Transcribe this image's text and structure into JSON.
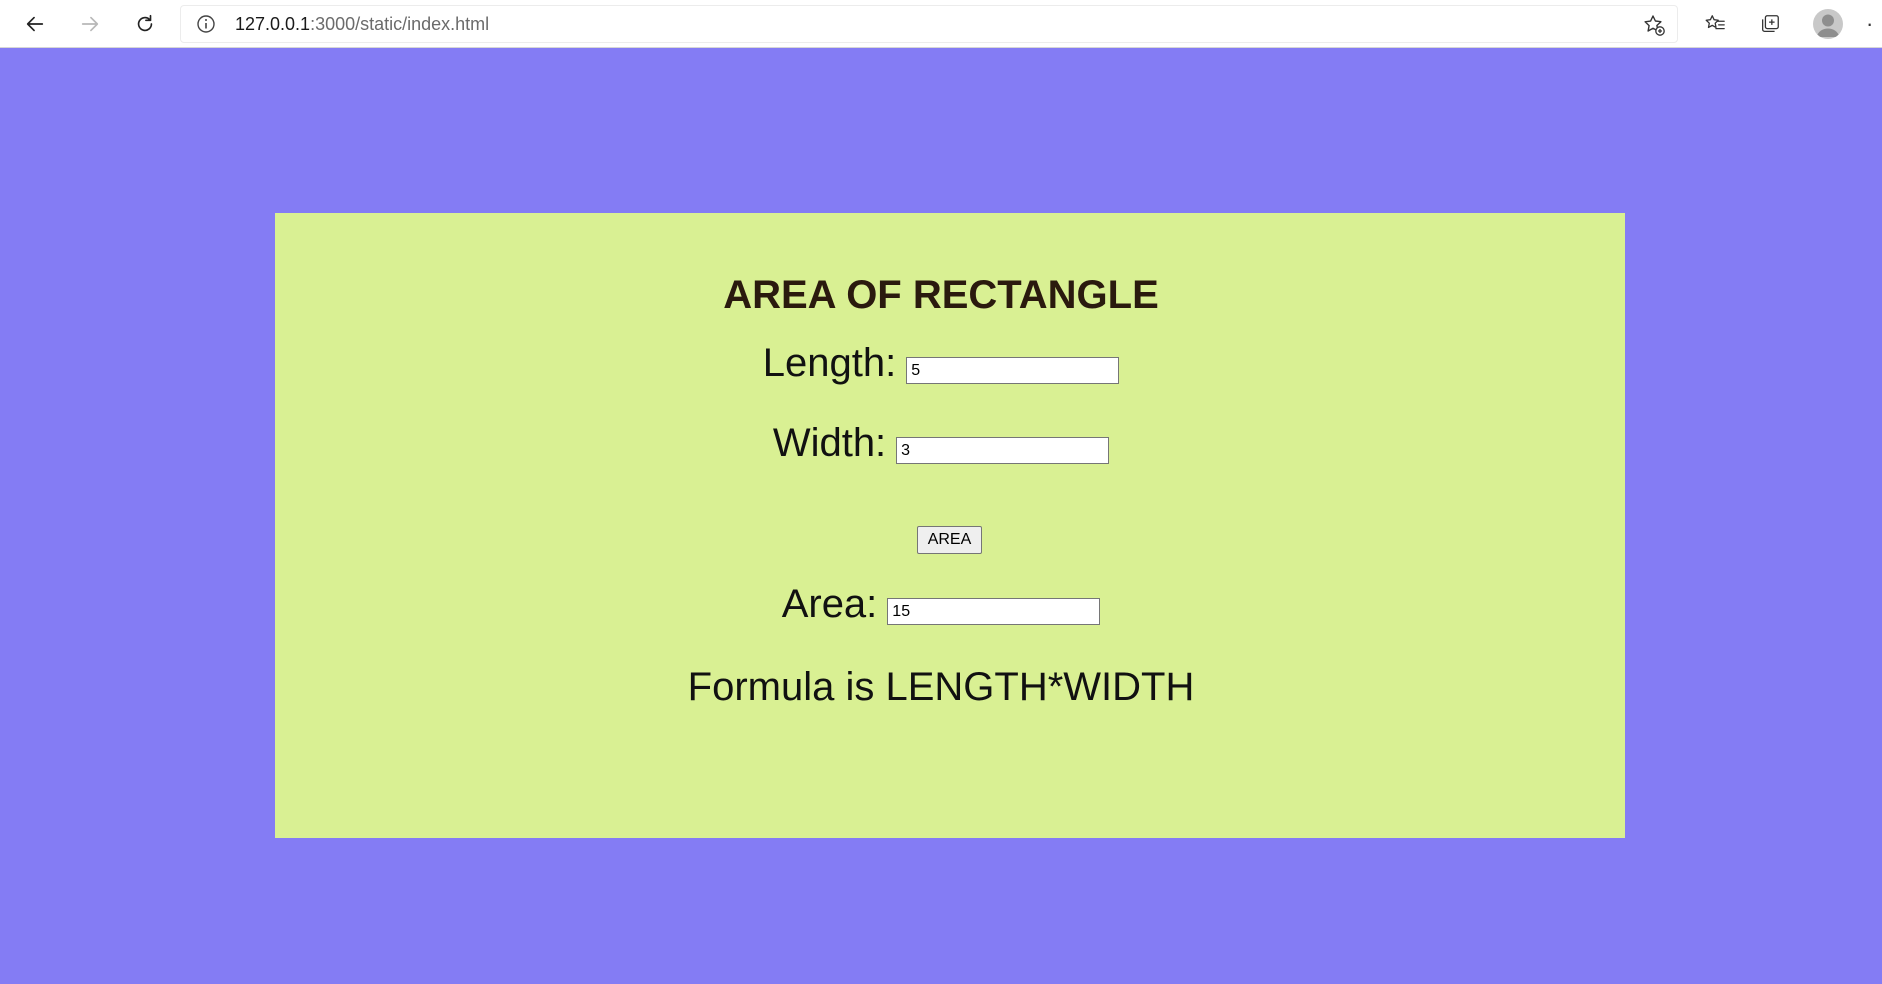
{
  "browser": {
    "url_host": "127.0.0.1",
    "url_path": ":3000/static/index.html",
    "icons": [
      "back-arrow-icon",
      "forward-arrow-icon",
      "reload-icon",
      "info-icon",
      "add-favorite-icon",
      "favorites-icon",
      "collections-icon",
      "profile-avatar",
      "more-icon"
    ]
  },
  "page": {
    "title": "AREA OF RECTANGLE",
    "length_label": "Length:",
    "length_value": "5",
    "width_label": "Width:",
    "width_value": "3",
    "area_button": "AREA",
    "area_label": "Area:",
    "area_value": "15",
    "formula": "Formula is LENGTH*WIDTH"
  },
  "colors": {
    "page_background": "#847cf4",
    "panel_background": "#d9f093",
    "title_color": "#2a1a0e"
  }
}
